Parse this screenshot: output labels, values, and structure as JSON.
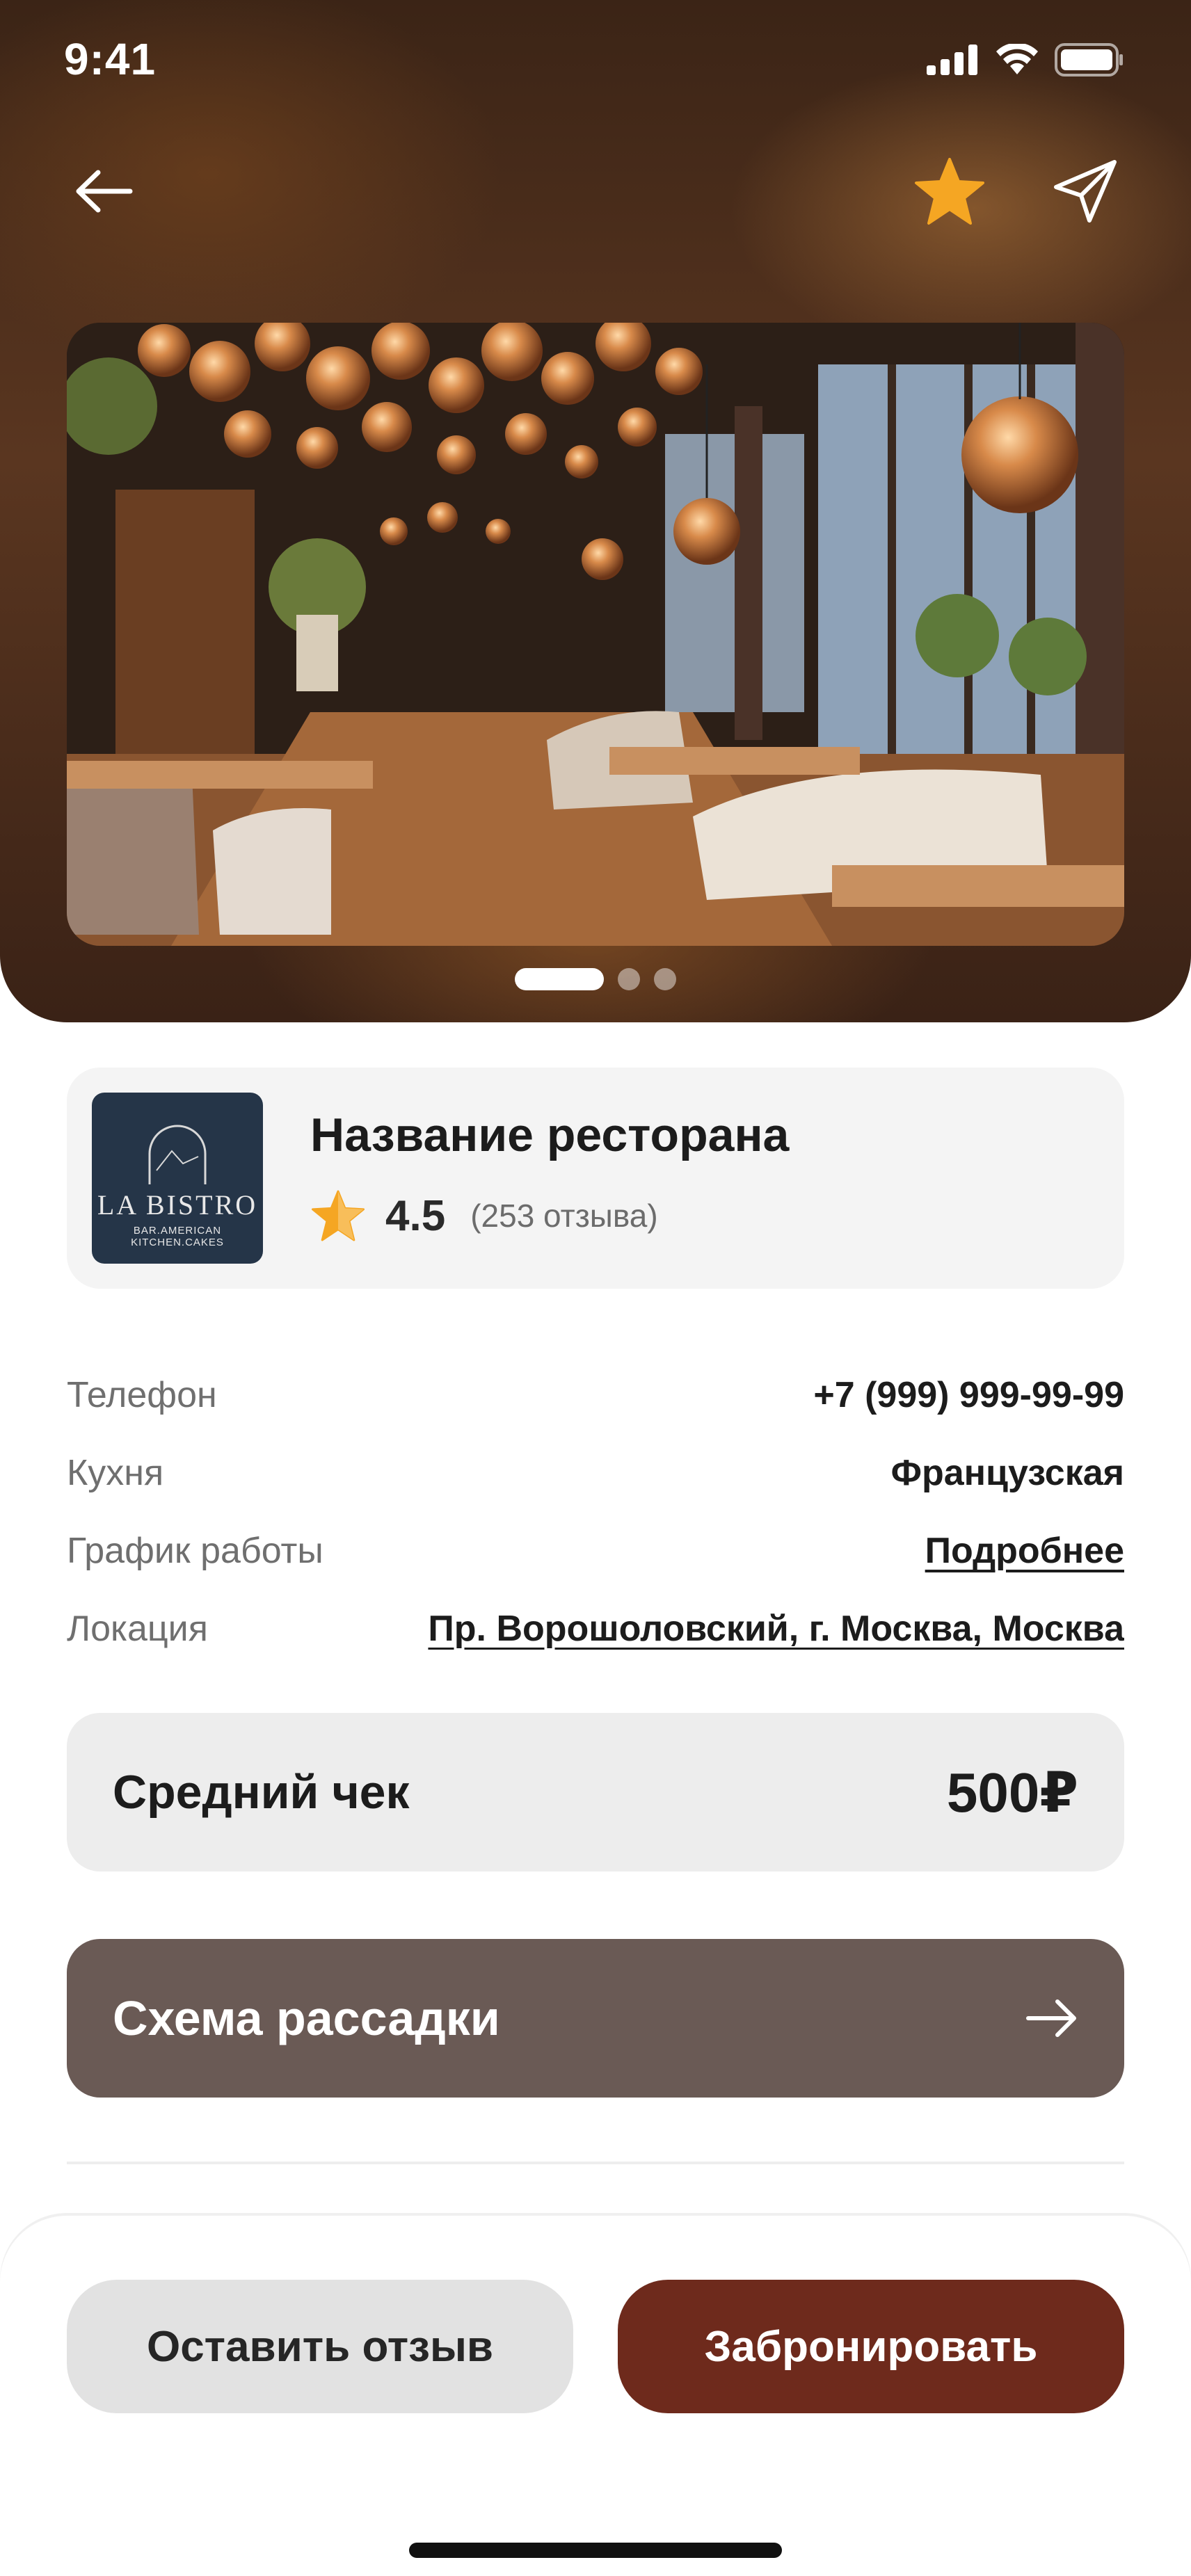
{
  "status_bar": {
    "time": "9:41"
  },
  "header": {
    "back_icon": "arrow-left-icon",
    "favorite_icon": "star-filled-icon",
    "share_icon": "paper-plane-icon",
    "favorite_color": "#f5a623"
  },
  "gallery": {
    "current_slide": 1,
    "total_slides": 3
  },
  "restaurant": {
    "name": "Название ресторана",
    "rating": "4.5",
    "reviews": "(253 отзыва)",
    "logo": {
      "brand": "LA BISTRO",
      "tagline": "BAR.AMERICAN KITCHEN.CAKES"
    }
  },
  "details": [
    {
      "label": "Телефон",
      "value": "+7 (999) 999-99-99"
    },
    {
      "label": "Кухня",
      "value": "Французская"
    },
    {
      "label": "График работы",
      "value": "Подробнее"
    },
    {
      "label": "Локация",
      "value": "Пр. Ворошоловский, г. Москва, Москва"
    }
  ],
  "average_check": {
    "label": "Средний чек",
    "value": "500₽"
  },
  "seating": {
    "label": "Схема рассадки",
    "icon": "arrow-right-icon"
  },
  "actions": {
    "review": "Оставить отзыв",
    "book": "Забронировать"
  },
  "colors": {
    "accent": "#6e2a1c",
    "scheme_button": "#6a5a55",
    "star": "#f5a623"
  }
}
